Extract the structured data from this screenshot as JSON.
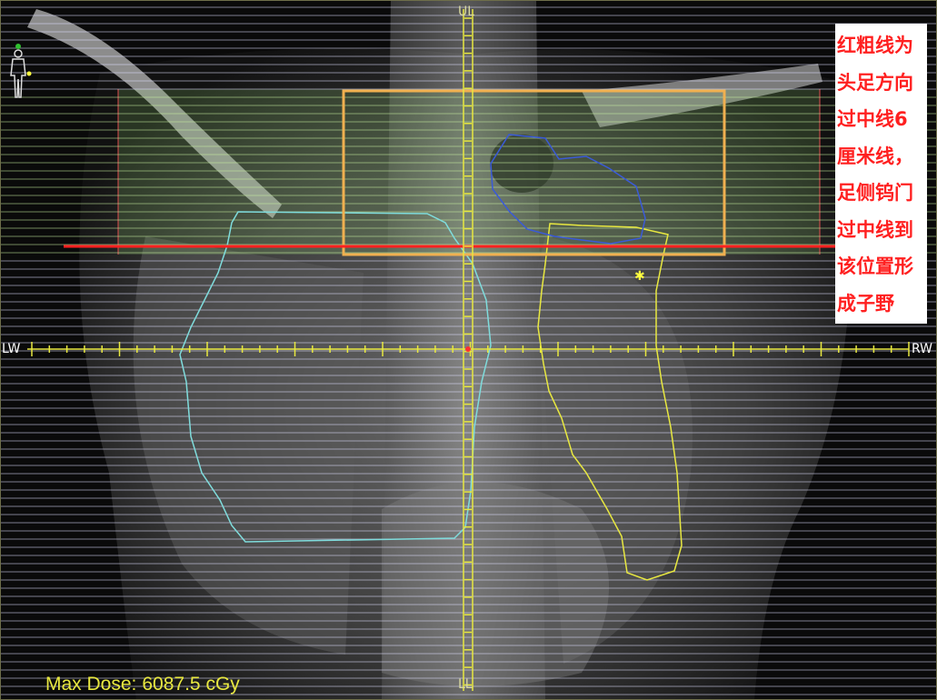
{
  "viewer": {
    "orientation": {
      "top": "UL",
      "bottom": "LL",
      "left": "LW",
      "right": "RW"
    },
    "max_dose": {
      "label": "Max Dose:",
      "value": "6087.5 cGy"
    },
    "annotation": {
      "lines": [
        "红粗线为",
        "头足方向",
        "过中线6",
        "厘米线，",
        "足侧钨门",
        "过中线到",
        "该位置形",
        "成子野"
      ]
    },
    "icons": {
      "patient_orientation": "patient-body-icon"
    },
    "colors": {
      "body_outline": "#7fdcdc",
      "right_lung_contour": "#e8e840",
      "gtv_contour": "#3a5ad8",
      "field_box": "#f0b050",
      "red_line": "#ff2020",
      "axis": "#e8e840",
      "mlc_leaf": "#ffffff",
      "annotation_text": "#ff2020"
    }
  }
}
